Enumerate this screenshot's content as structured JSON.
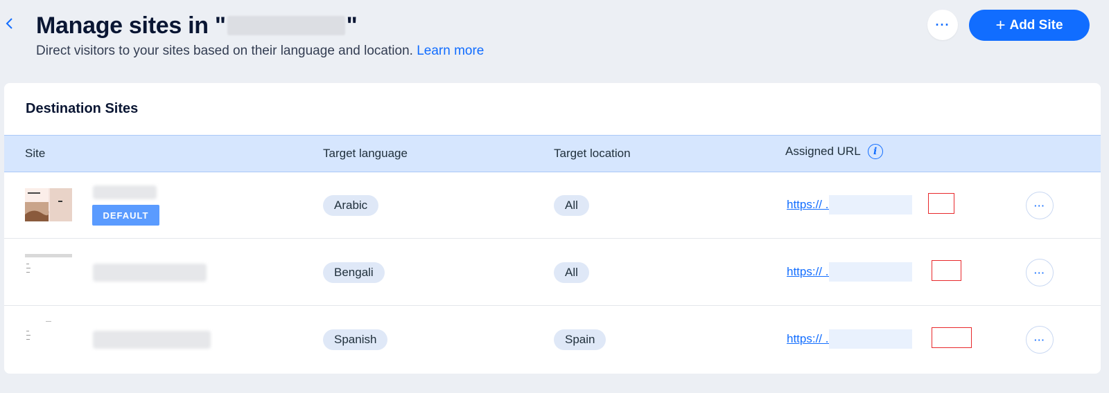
{
  "header": {
    "title_prefix": "Manage sites in \"",
    "title_suffix": "\"",
    "subtitle": "Direct visitors to your sites based on their language and location.",
    "learn_more": "Learn more",
    "more_label": "···",
    "add_site_label": "Add Site",
    "add_site_icon": "+"
  },
  "card": {
    "title": "Destination Sites",
    "columns": {
      "site": "Site",
      "language": "Target language",
      "location": "Target location",
      "url": "Assigned URL"
    },
    "info_icon": "i",
    "rows": [
      {
        "default_badge": "DEFAULT",
        "language": "Arabic",
        "location": "All",
        "url": "https://            .org/ar/lab/s…"
      },
      {
        "language": "Bengali",
        "location": "All",
        "url": "https://            .org/bn/lab/…"
      },
      {
        "language": "Spanish",
        "location": "Spain",
        "url": "https://            .org/es-es/la…"
      }
    ],
    "row_more_label": "···"
  },
  "colors": {
    "accent": "#116dff",
    "header_bg": "#d6e6fe",
    "default_badge": "#5a9bff",
    "highlight_box": "#e8282b"
  }
}
